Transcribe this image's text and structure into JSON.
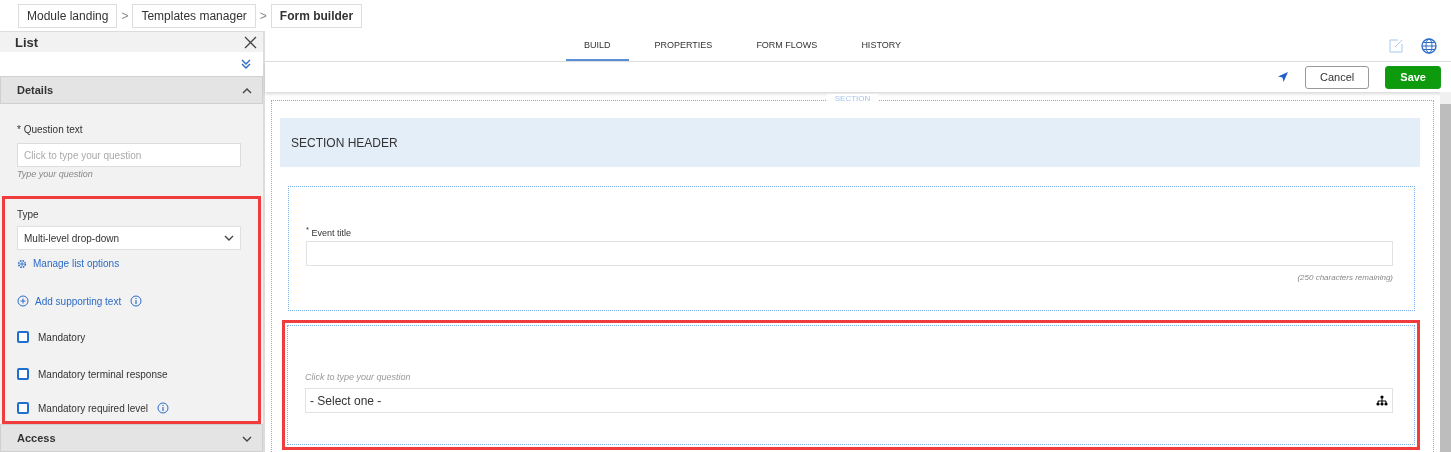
{
  "breadcrumbs": [
    {
      "label": "Module landing",
      "current": false
    },
    {
      "separator": ">",
      "label": "Templates manager",
      "current": false
    },
    {
      "separator": ">",
      "label": "Form builder",
      "current": true
    }
  ],
  "panel": {
    "title": "List",
    "details": {
      "title": "Details",
      "expanded": true
    },
    "question": {
      "label": "* Question text",
      "placeholder": "Click to type your question",
      "hint": "Type your question"
    },
    "options": {
      "highlighted": true,
      "type_label": "Type",
      "type_value": "Multi-level drop-down",
      "manage_link": "Manage list options",
      "supporting_link": "Add supporting text",
      "checkboxes": [
        {
          "label": "Mandatory",
          "checked": false,
          "info": false
        },
        {
          "label": "Mandatory terminal response",
          "checked": false,
          "info": false
        },
        {
          "label": "Mandatory required level",
          "checked": false,
          "info": true
        }
      ]
    },
    "access": {
      "title": "Access",
      "expanded": false
    }
  },
  "tabs": [
    {
      "label": "BUILD",
      "selected": true
    },
    {
      "label": "PROPERTIES",
      "selected": false
    },
    {
      "label": "FORM FLOWS",
      "selected": false
    },
    {
      "label": "HISTORY",
      "selected": false
    }
  ],
  "actions": {
    "cancel": "Cancel",
    "save": "Save"
  },
  "section": {
    "label": "SECTION",
    "header": "SECTION HEADER",
    "questions": [
      {
        "kind": "text",
        "label": "$^{*}$ Event title",
        "note": "(250 characters remaining)",
        "highlighted": false
      },
      {
        "kind": "list",
        "placeholder": "Click to type your question",
        "value": "- Select one -",
        "highlighted": true
      }
    ]
  }
}
